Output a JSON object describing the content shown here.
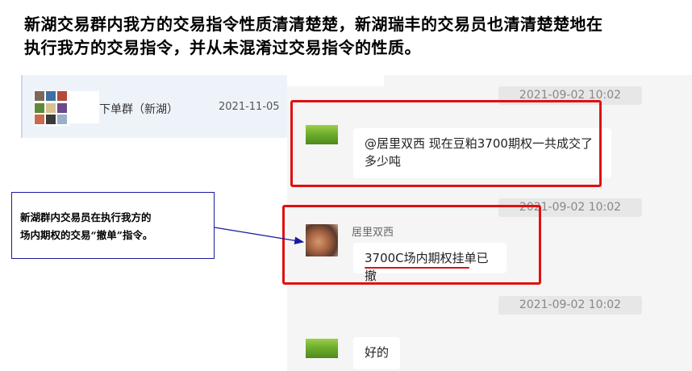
{
  "headline": {
    "line1": "新湖交易群内我方的交易指令性质清清楚楚，新湖瑞丰的交易员也清清楚楚地在",
    "line2": "执行我方的交易指令，并从未混淆过交易指令的性质。"
  },
  "chat_list": {
    "item": {
      "name": "下单群（新湖）",
      "date": "2021-11-05"
    }
  },
  "conversation": {
    "messages": [
      {
        "time": "2021-09-02 10:02",
        "sender": "",
        "text_line1": "@居里双西 现在豆粕3700期权一共成交了",
        "text_line2": "多少吨"
      },
      {
        "time": "2021-09-02 10:02",
        "sender": "居里双西",
        "text": "3700C场内期权挂单已撤"
      },
      {
        "time": "2021-09-02 10:02",
        "sender": "",
        "text": "好的"
      }
    ]
  },
  "callout": {
    "line1": "新湖群内交易员在执行我方的",
    "line2": "场内期权的交易“撤单”指令。"
  },
  "colors": {
    "highlight_red": "#e01010",
    "callout_border": "#1a1aa0",
    "arrow": "#1a1aa0"
  }
}
